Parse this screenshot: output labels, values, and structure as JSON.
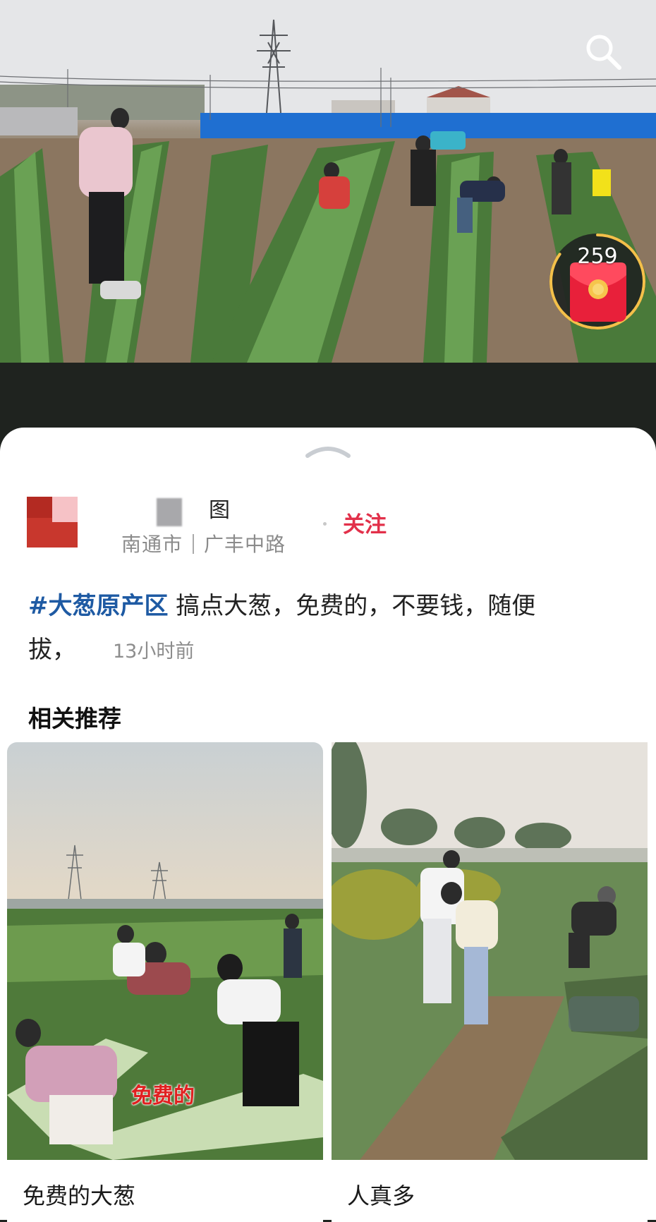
{
  "video": {
    "search_icon": "search-icon",
    "red_packet": {
      "count": "259",
      "icon": "red-envelope-icon",
      "progress": 0.85
    }
  },
  "sheet": {
    "handle_icon": "chevron-up-icon",
    "author": {
      "name_visible_char": "图",
      "location_city": "南通市",
      "location_road": "广丰中路",
      "follow_label": "关注"
    },
    "post": {
      "hashtag": "#大葱原产区",
      "text_line1": " 搞点大葱，免费的，不要钱，随便",
      "text_line2": "拔，",
      "time": "13小时前"
    },
    "related": {
      "title": "相关推荐",
      "cards": [
        {
          "title": "免费的大葱",
          "overlay_text": "免费的"
        },
        {
          "title": "人真多"
        }
      ]
    }
  },
  "colors": {
    "follow": "#e2304a",
    "hashtag": "#1e5aa3",
    "dark_bg": "#1f231f"
  }
}
